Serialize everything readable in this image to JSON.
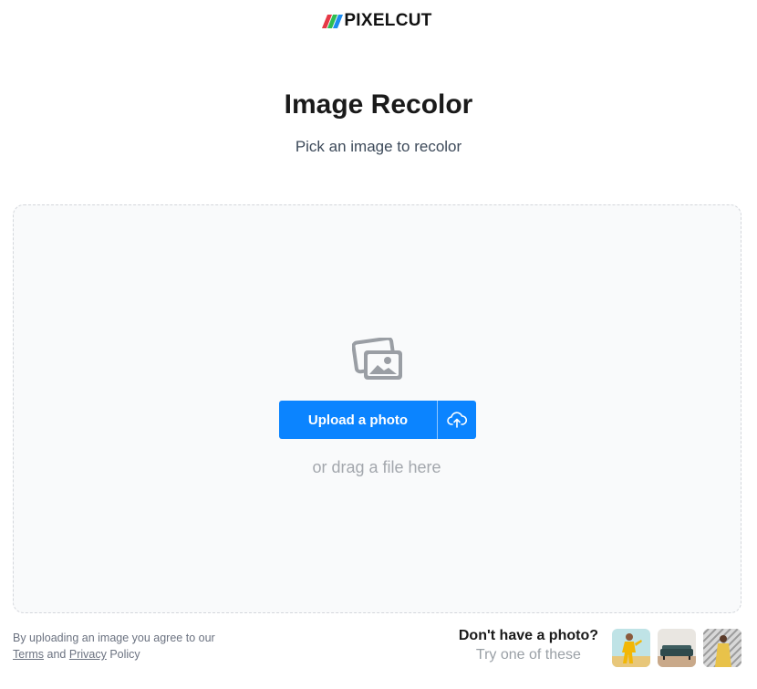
{
  "brand": {
    "name": "PIXELCUT",
    "colors": [
      "#e63946",
      "#2dbd52",
      "#1d8cf0"
    ]
  },
  "header": {
    "title": "Image Recolor",
    "subtitle": "Pick an image to recolor"
  },
  "dropzone": {
    "icon": "photos-icon",
    "upload_label": "Upload a photo",
    "upload_icon": "cloud-upload-icon",
    "drag_text": "or drag a file here"
  },
  "footer": {
    "terms_prefix": "By uploading an image you agree to our",
    "terms_link": "Terms",
    "and": "and",
    "privacy_link": "Privacy",
    "policy": "Policy",
    "try_title": "Don't have a photo?",
    "try_sub": "Try one of these",
    "samples": [
      "sample-photo-yellow-outfit",
      "sample-photo-sofa",
      "sample-photo-woman-pattern"
    ]
  },
  "colors": {
    "accent": "#0b84ff",
    "dropzone_bg": "#f9fafb",
    "muted_text": "#a3a7ad"
  }
}
